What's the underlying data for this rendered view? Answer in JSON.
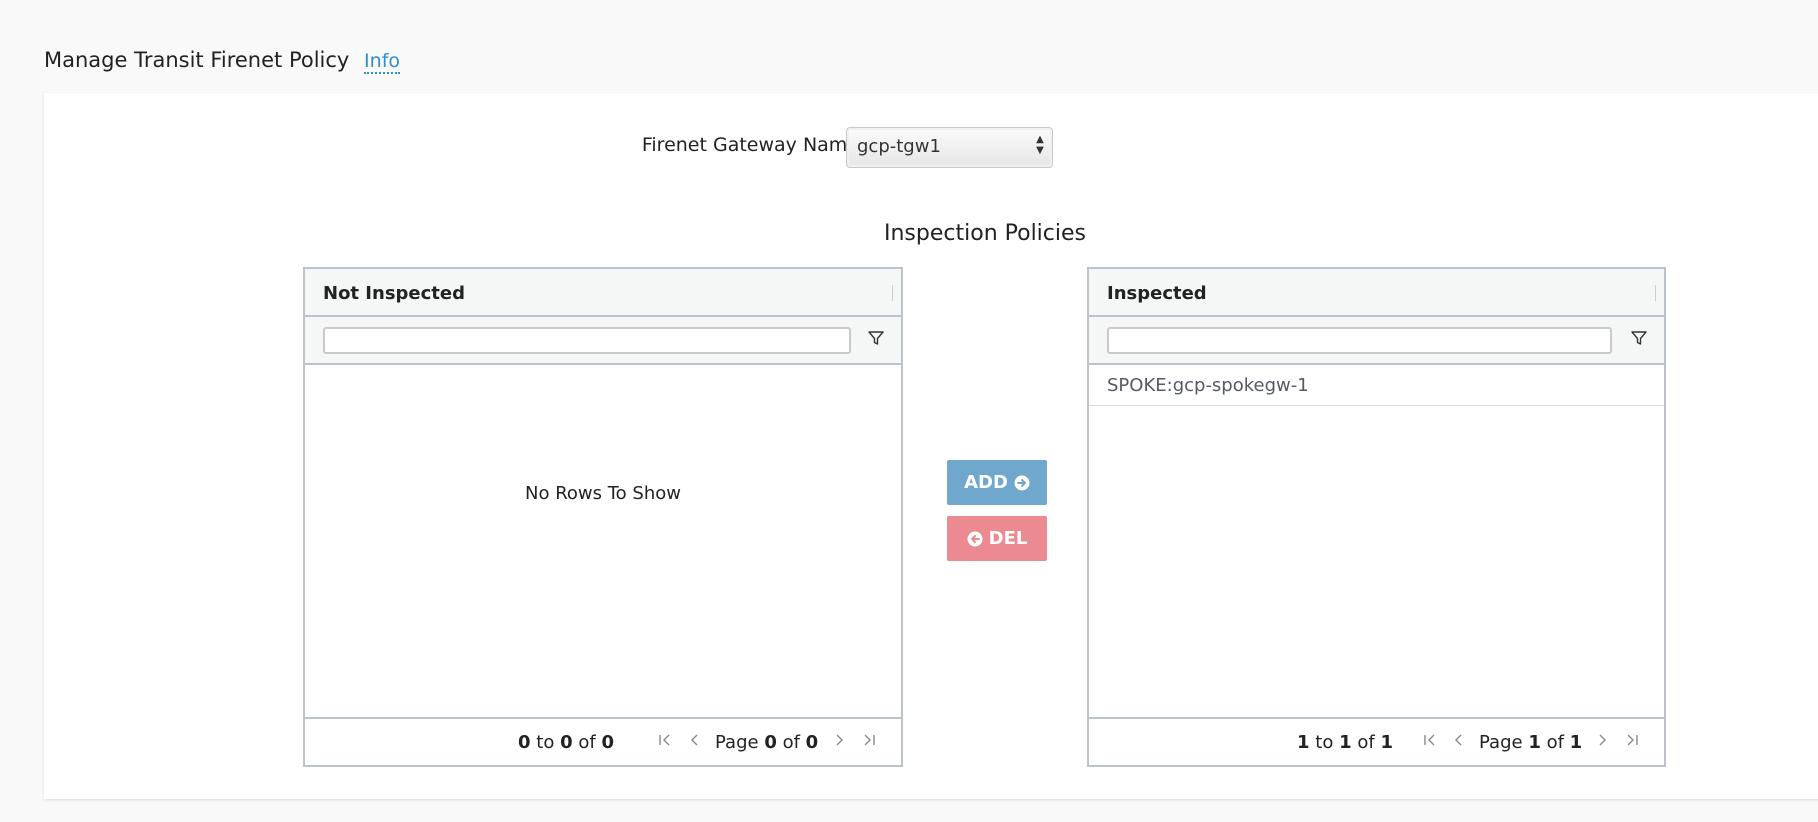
{
  "page": {
    "title": "Manage Transit Firenet Policy",
    "info_link": "Info"
  },
  "gateway": {
    "label": "Firenet Gateway Name",
    "selected": "gcp-tgw1"
  },
  "section": {
    "title": "Inspection Policies"
  },
  "not_inspected": {
    "header": "Not Inspected",
    "empty_message": "No Rows To Show",
    "rows": [],
    "footer": {
      "from": "0",
      "to_word": "to",
      "to": "0",
      "of_word": "of",
      "total": "0",
      "page_word": "Page",
      "page": "0",
      "page_of_word": "of",
      "pages": "0"
    }
  },
  "inspected": {
    "header": "Inspected",
    "rows": [
      {
        "name": "SPOKE:gcp-spokegw-1"
      }
    ],
    "footer": {
      "from": "1",
      "to_word": "to",
      "to": "1",
      "of_word": "of",
      "total": "1",
      "page_word": "Page",
      "page": "1",
      "page_of_word": "of",
      "pages": "1"
    }
  },
  "actions": {
    "add_label": "ADD",
    "del_label": "DEL"
  },
  "colors": {
    "add_button": "#6fa8cc",
    "del_button": "#ec8a91",
    "info_link": "#2f8fc7"
  },
  "icons": {
    "filter": "filter-icon",
    "first": "first-page-icon",
    "prev": "prev-page-icon",
    "next": "next-page-icon",
    "last": "last-page-icon",
    "add": "arrow-circle-right-icon",
    "del": "arrow-circle-left-icon"
  }
}
